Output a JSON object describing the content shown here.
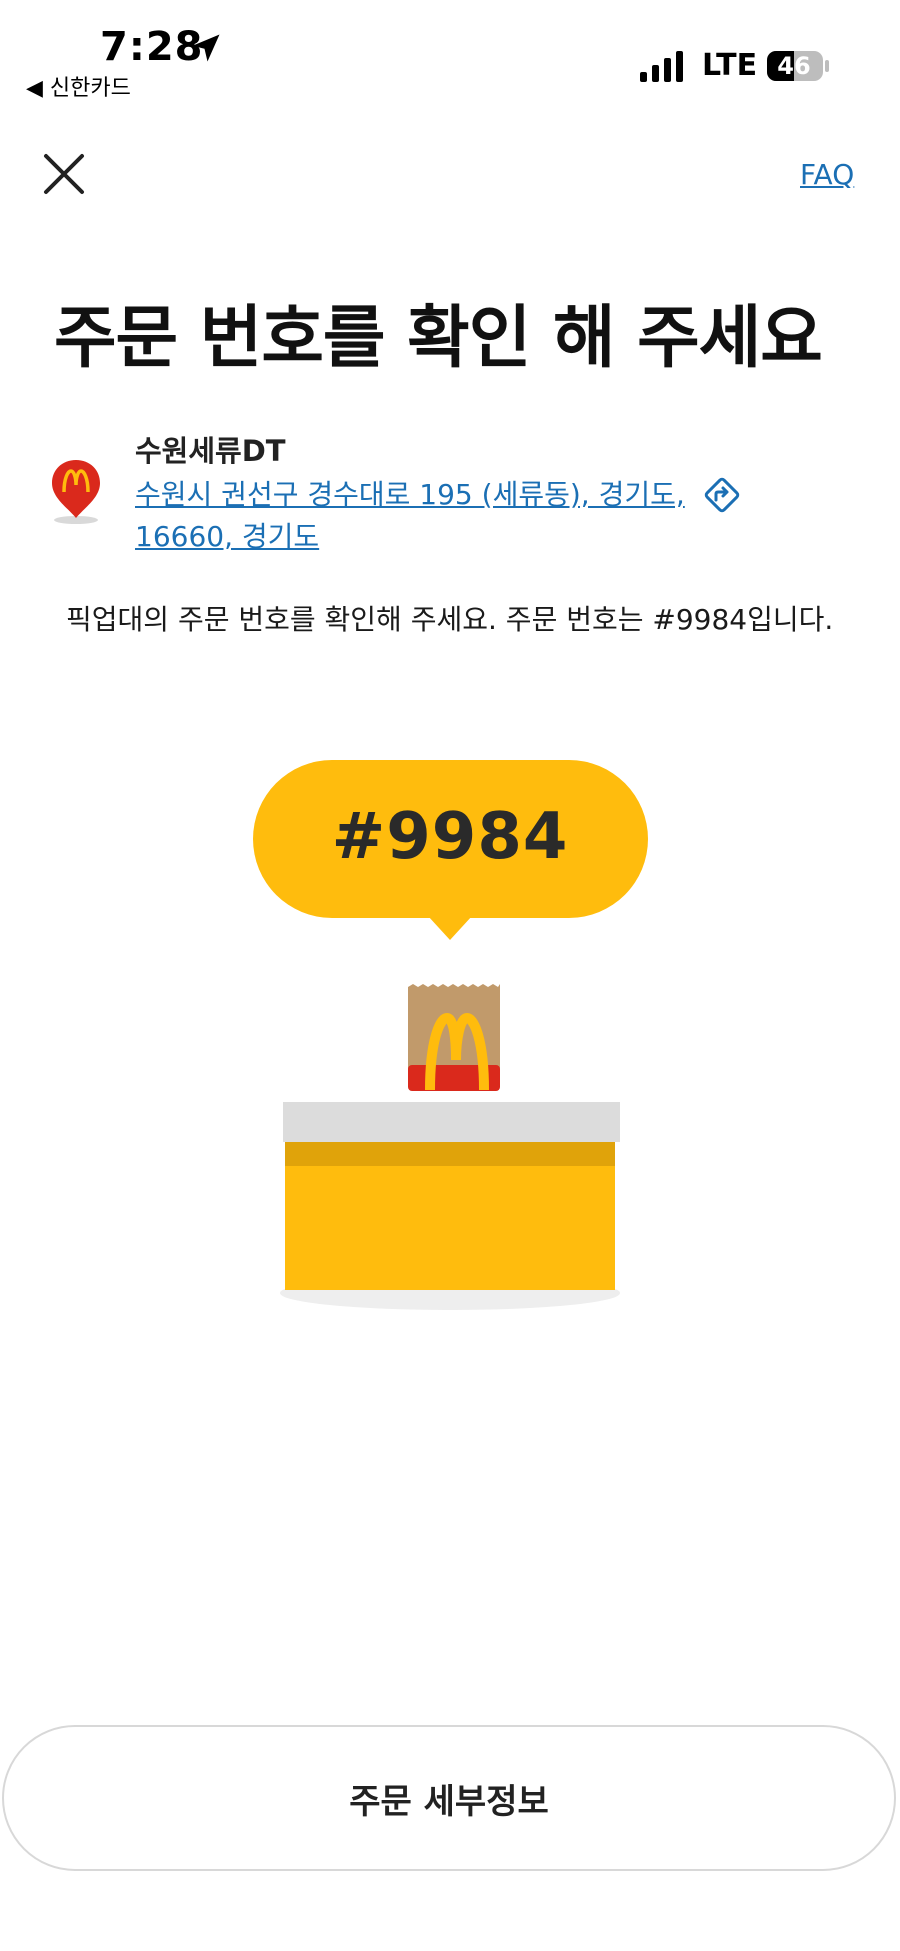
{
  "status_bar": {
    "time": "7:28",
    "back_app": "◀ 신한카드",
    "network": "LTE",
    "battery": "46"
  },
  "nav": {
    "close_icon": "close-icon",
    "faq_label": "FAQ"
  },
  "title": "주문 번호를 확인 해 주세요",
  "store": {
    "name": "수원세류DT",
    "address": "수원시 권선구 경수대로 195 (세류동), 경기도, 16660, 경기도",
    "pin_icon": "mcdonalds-pin-icon",
    "directions_icon": "directions-icon"
  },
  "description": "픽업대의 주문 번호를 확인해 주세요. 주문 번호는 #9984입니다.",
  "order_number": "#9984",
  "bottom_button": {
    "label": "주문 세부정보"
  },
  "colors": {
    "brand_yellow": "#FFBC0D",
    "brand_red": "#DA291C",
    "link_blue": "#1b6fb4"
  }
}
